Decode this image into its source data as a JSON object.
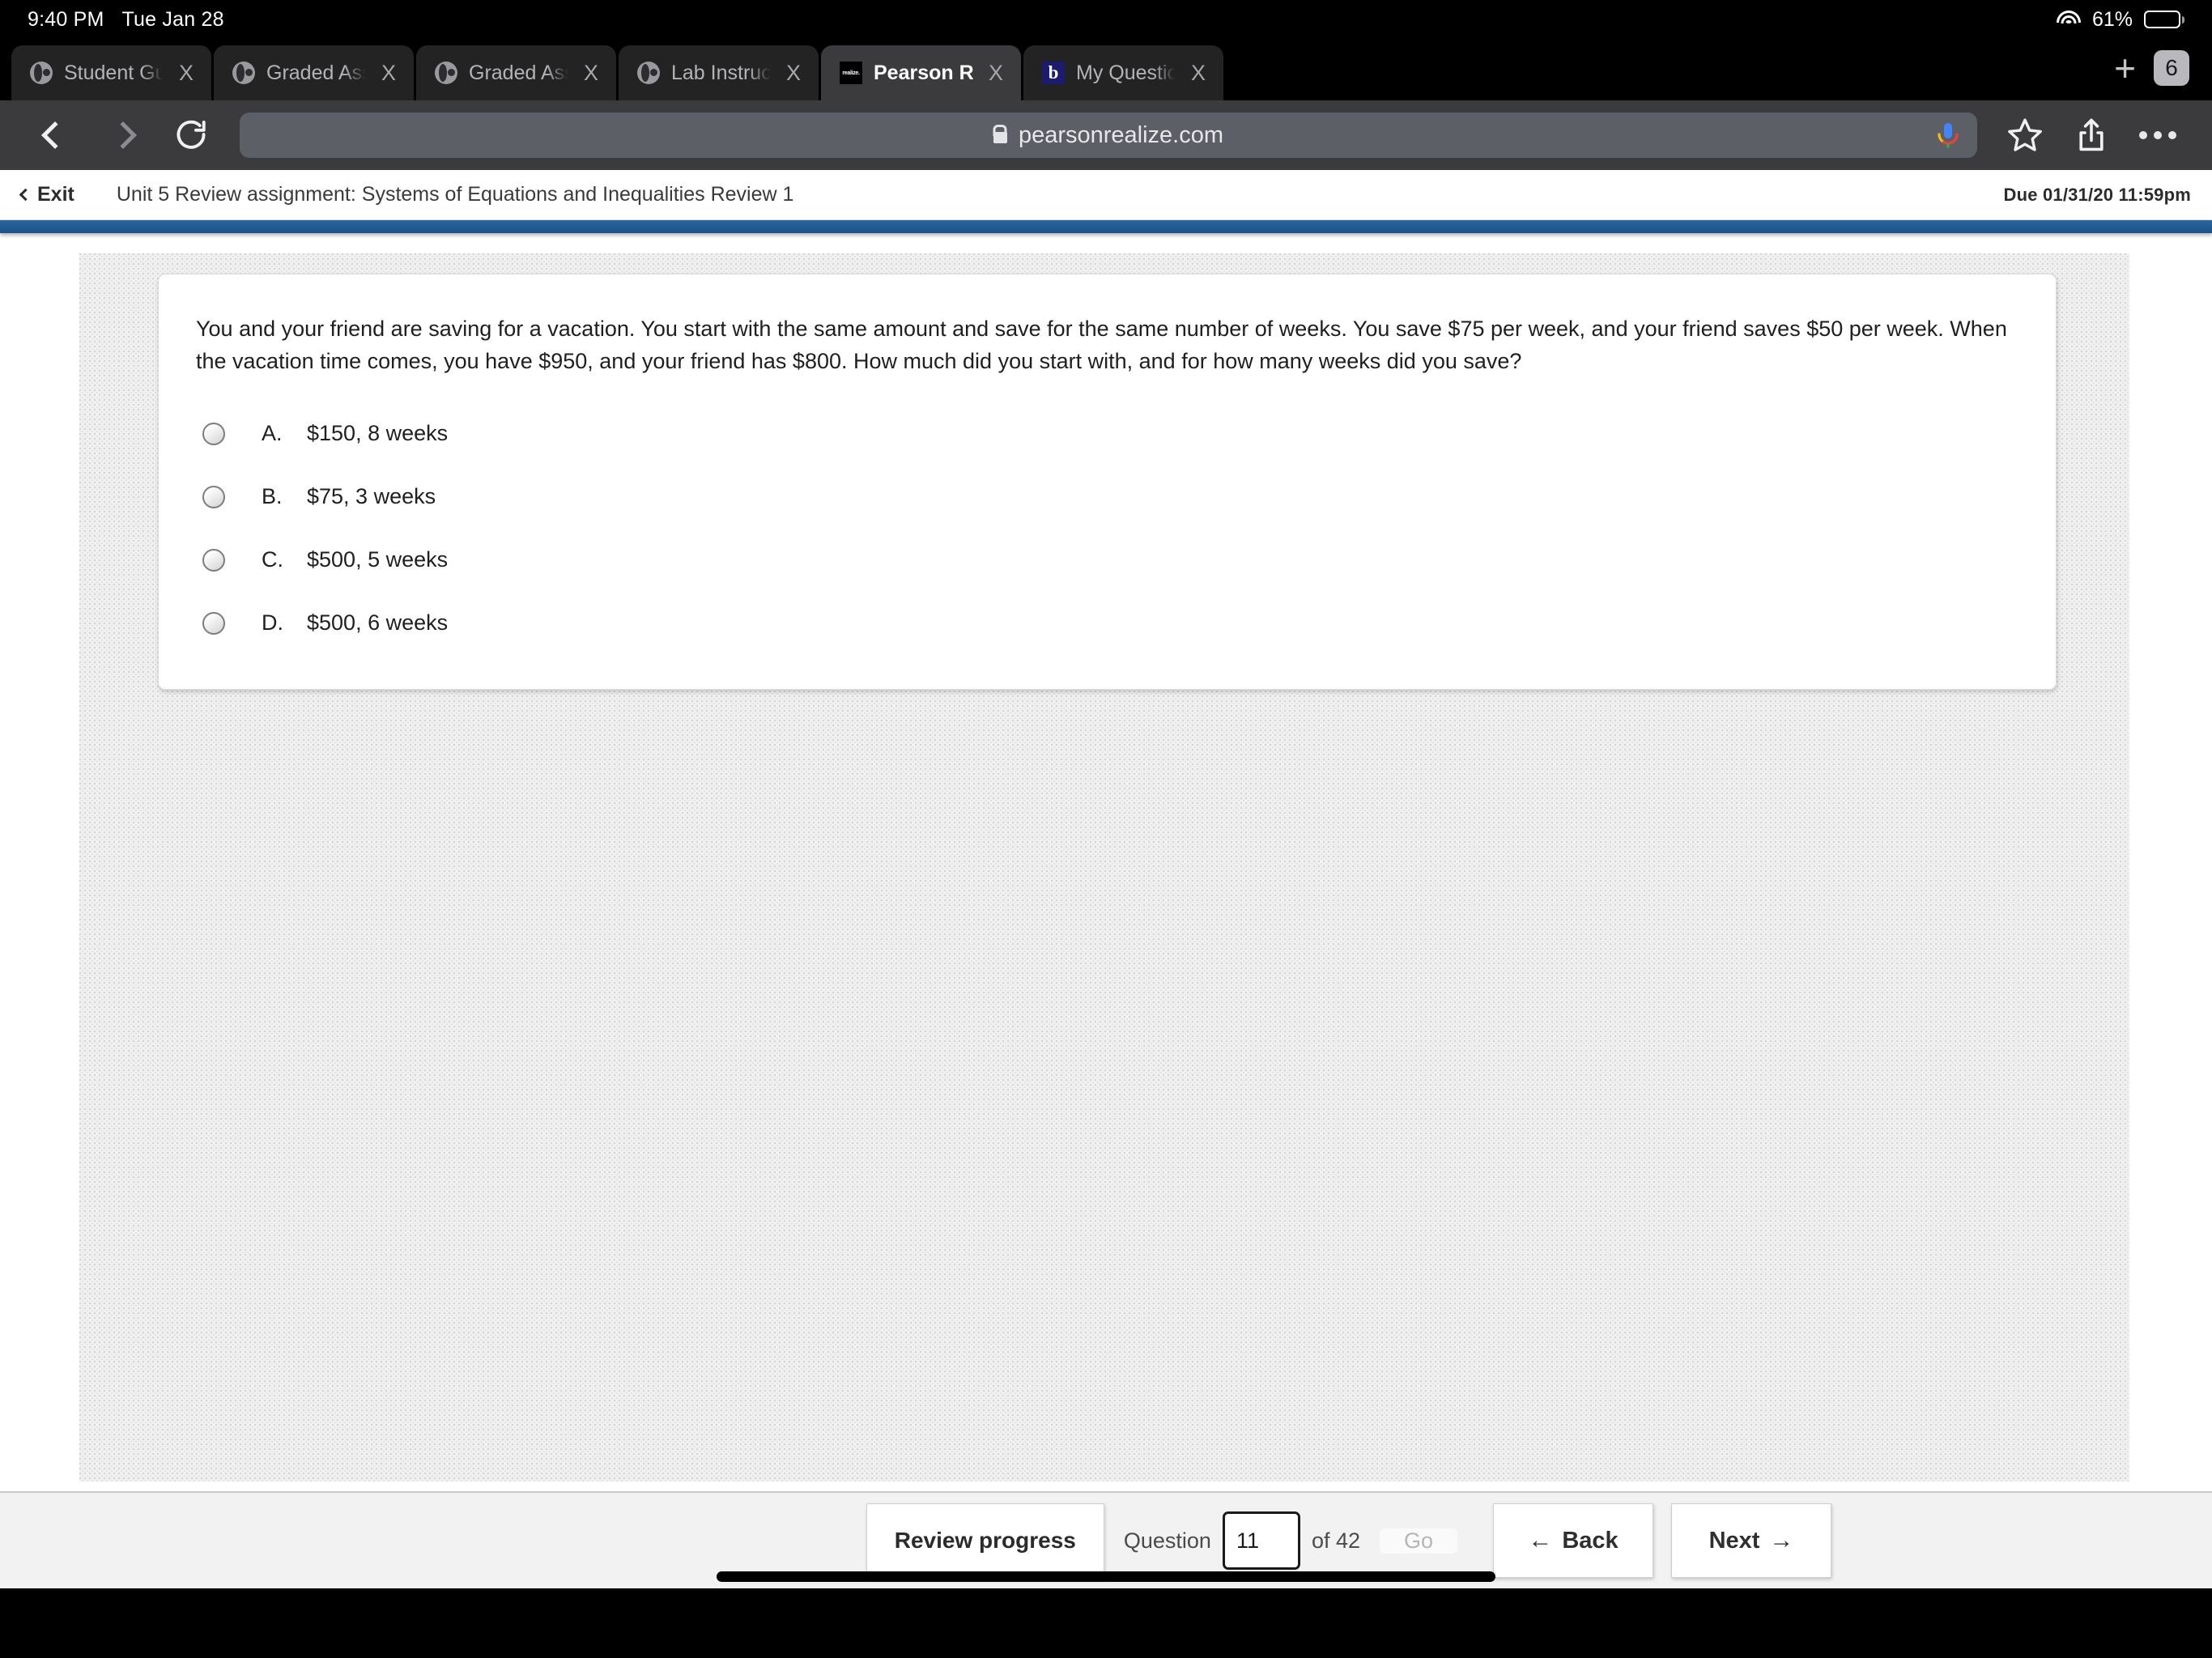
{
  "status_bar": {
    "time": "9:40 PM",
    "date": "Tue Jan 28",
    "battery_percent": "61%",
    "wifi_icon": "wifi-icon",
    "battery_icon": "battery-icon"
  },
  "browser": {
    "tabs": [
      {
        "title": "Student Guide: Labor",
        "favicon": "globe-icon",
        "active": false
      },
      {
        "title": "Graded Assignment -",
        "favicon": "globe-icon",
        "active": false
      },
      {
        "title": "Graded Assignment A",
        "favicon": "globe-icon",
        "active": false
      },
      {
        "title": "Lab Instructions",
        "favicon": "globe-icon",
        "active": false
      },
      {
        "title": "Pearson Realize",
        "favicon": "realize-favicon",
        "active": true
      },
      {
        "title": "My Questions | bartle",
        "favicon": "bartleby-favicon",
        "active": false
      }
    ],
    "close_label": "X",
    "new_tab_label": "+",
    "tab_count": "6",
    "back_icon": "chevron-left-icon",
    "forward_icon": "chevron-right-icon",
    "reload_icon": "reload-icon",
    "url": "pearsonrealize.com",
    "lock_icon": "lock-icon",
    "mic_icon": "google-mic-icon",
    "bookmark_icon": "star-icon",
    "share_icon": "share-icon",
    "more_icon": "more-dots-icon",
    "favicon_realize_text": "realize."
  },
  "page_header": {
    "exit_label": "Exit",
    "exit_icon": "chevron-left-icon",
    "assignment_title": "Unit 5 Review assignment: Systems of Equations and Inequalities Review 1",
    "due_text": "Due 01/31/20 11:59pm"
  },
  "question": {
    "prompt": "You and your friend are saving for a vacation. You start with the same amount and save for the same number of weeks. You save $75 per week, and your friend saves $50 per week. When the vacation time comes, you have $950, and your friend has $800. How much did you start with, and for how many weeks did you save?",
    "choices": [
      {
        "letter": "A.",
        "text": "$150, 8 weeks",
        "selected": false
      },
      {
        "letter": "B.",
        "text": "$75, 3 weeks",
        "selected": false
      },
      {
        "letter": "C.",
        "text": "$500, 5 weeks",
        "selected": false
      },
      {
        "letter": "D.",
        "text": "$500, 6 weeks",
        "selected": false
      }
    ]
  },
  "bottom_bar": {
    "review_progress_label": "Review progress",
    "question_label": "Question",
    "question_number": "11",
    "of_label": "of 42",
    "go_label": "Go",
    "back_label": "Back",
    "back_icon": "arrow-left-icon",
    "next_label": "Next",
    "next_icon": "arrow-right-icon"
  },
  "colors": {
    "accent_blue": "#215b92",
    "chrome_dark": "#3b3b3d",
    "tab_black": "#000000",
    "content_bg": "#f0f0f0"
  }
}
